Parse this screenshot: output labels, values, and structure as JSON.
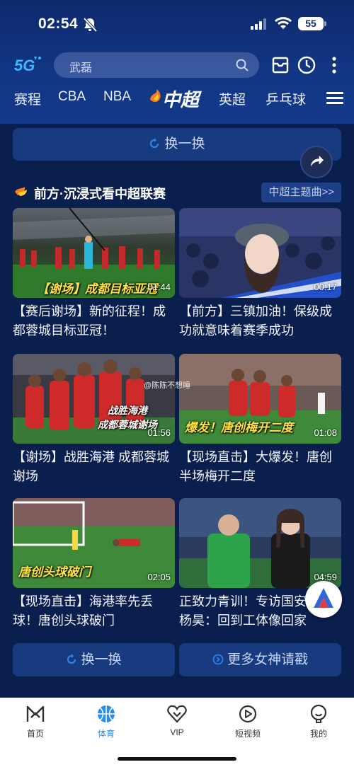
{
  "status_bar": {
    "time": "02:54",
    "battery": "55"
  },
  "header": {
    "logo_text": "5G",
    "search_placeholder": "武磊",
    "icons": [
      "search-icon",
      "inbox-icon",
      "history-clock-icon",
      "more-vertical-icon"
    ]
  },
  "tabs": [
    {
      "label": "赛程"
    },
    {
      "label": "CBA"
    },
    {
      "label": "NBA"
    },
    {
      "label": "中超",
      "active": true
    },
    {
      "label": "英超"
    },
    {
      "label": "乒乓球"
    }
  ],
  "swap_top": {
    "label": "换一换"
  },
  "section": {
    "title": "前方·沉浸式看中超联赛",
    "link": "中超主题曲>>"
  },
  "cards": [
    {
      "title": "【赛后谢场】新的征程！成都蓉城目标亚冠！",
      "overlay": "【谢场】成都目标亚冠",
      "duration": "01:44"
    },
    {
      "title": "【前方】三镇加油！保级成功就意味着赛季成功",
      "overlay": "",
      "duration": "00:17"
    },
    {
      "title": "【谢场】战胜海港 成都蓉城谢场",
      "overlay": "战胜海港\n成都蓉城谢场",
      "overlay_line1": "战胜海港",
      "overlay_line2": "成都蓉城谢场",
      "watermark": "@陈陈不想睡",
      "duration": "01:56"
    },
    {
      "title": "【现场直击】大爆发！唐创半场梅开二度",
      "overlay": "爆发！唐创梅开二度",
      "duration": "01:08"
    },
    {
      "title": "【现场直击】海港率先丢球！唐创头球破门",
      "overlay": "唐创头球破门",
      "duration": "02:05"
    },
    {
      "title": "正致力青训！专访国安宿将杨昊：回到工体像回家",
      "overlay": "",
      "duration": "04:59"
    }
  ],
  "bottom_buttons": {
    "swap": "换一换",
    "more": "更多女神请戳"
  },
  "bottom_nav": [
    {
      "label": "首页",
      "icon": "home-m-icon"
    },
    {
      "label": "体育",
      "icon": "basketball-icon",
      "active": true
    },
    {
      "label": "VIP",
      "icon": "vip-heart-icon"
    },
    {
      "label": "短视频",
      "icon": "play-circle-icon"
    },
    {
      "label": "我的",
      "icon": "profile-icon"
    }
  ],
  "colors": {
    "background": "#0b1f4f",
    "header": "#123684",
    "button": "#183a7e",
    "accent_active_nav": "#2b8ee8",
    "caption_yellow": "#ffe04a"
  }
}
